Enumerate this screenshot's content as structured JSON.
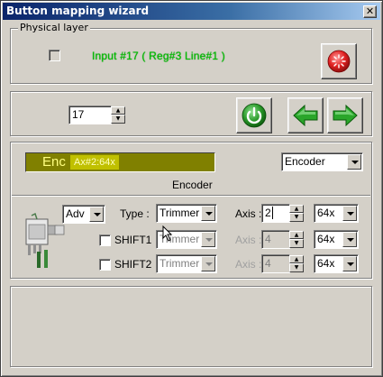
{
  "window": {
    "title": "Button mapping wizard",
    "close_label": "✕"
  },
  "physical": {
    "group_label": "Physical layer",
    "input_text": "Input #17  ( Reg#3  Line#1 )"
  },
  "nav": {
    "input_value": "17"
  },
  "encoder": {
    "bar_label": "Enc",
    "bar_tag": "Ax#2:64x",
    "caption": "Encoder",
    "mode_select": "Encoder"
  },
  "mapping": {
    "adv_select": "Adv",
    "type_label": "Type :",
    "axis_label": "Axis :",
    "rows": [
      {
        "shift_label": "",
        "type": "Trimmer",
        "axis": "2",
        "scale": "64x",
        "enabled": true
      },
      {
        "shift_label": "SHIFT1",
        "type": "Trimmer",
        "axis": "4",
        "scale": "64x",
        "enabled": false
      },
      {
        "shift_label": "SHIFT2",
        "type": "Trimmer",
        "axis": "4",
        "scale": "64x",
        "enabled": false
      }
    ]
  },
  "icons": {
    "record": "record-icon",
    "refresh": "power-refresh-icon",
    "prev": "arrow-left-icon",
    "next": "arrow-right-icon",
    "encoder": "rotary-encoder-icon"
  },
  "colors": {
    "titlebar_start": "#0a246a",
    "status_green": "#00c000",
    "encoder_bar": "#808000",
    "record_red": "#e02020",
    "button_green": "#2a9a2a"
  }
}
